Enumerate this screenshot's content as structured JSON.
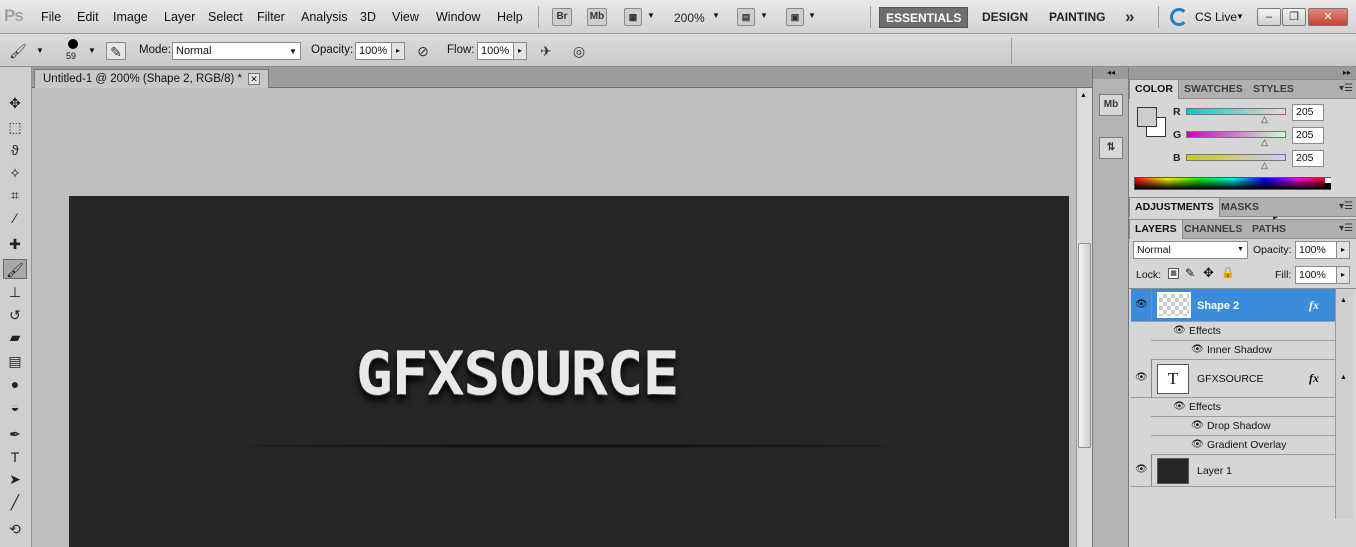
{
  "menubar": {
    "logo": "Ps",
    "items": [
      "File",
      "Edit",
      "Image",
      "Layer",
      "Select",
      "Filter",
      "Analysis",
      "3D",
      "View",
      "Window",
      "Help"
    ],
    "br_label": "Br",
    "mb_label": "Mb",
    "zoom": "200%",
    "workspaces": {
      "essentials": "ESSENTIALS",
      "design": "DESIGN",
      "painting": "PAINTING"
    },
    "more": "»",
    "cs_live": "CS Live",
    "win_min": "–",
    "win_restore": "❐",
    "win_close": "✕"
  },
  "options": {
    "brush_size": "59",
    "mode_label": "Mode:",
    "mode_value": "Normal",
    "opacity_label": "Opacity:",
    "opacity_value": "100%",
    "flow_label": "Flow:",
    "flow_value": "100%"
  },
  "document": {
    "tab_title": "Untitled-1 @ 200% (Shape 2, RGB/8) *",
    "close": "✕",
    "canvas_text": "GFXSOURCE",
    "canvas_color": "#262626"
  },
  "color_panel": {
    "tabs": [
      "COLOR",
      "SWATCHES",
      "STYLES"
    ],
    "channels": [
      {
        "label": "R",
        "value": "205",
        "fraction": 0.8
      },
      {
        "label": "G",
        "value": "205",
        "fraction": 0.8
      },
      {
        "label": "B",
        "value": "205",
        "fraction": 0.8
      }
    ]
  },
  "adjust_panel": {
    "tabs": [
      "ADJUSTMENTS",
      "MASKS"
    ]
  },
  "layers_panel": {
    "tabs": [
      "LAYERS",
      "CHANNELS",
      "PATHS"
    ],
    "blend_mode": "Normal",
    "opacity_label": "Opacity:",
    "opacity_value": "100%",
    "lock_label": "Lock:",
    "fill_label": "Fill:",
    "fill_value": "100%",
    "layers": [
      {
        "name": "Shape 2",
        "effects_label": "Effects",
        "effects": [
          "Inner Shadow"
        ]
      },
      {
        "name": "GFXSOURCE",
        "thumb_glyph": "T",
        "effects_label": "Effects",
        "effects": [
          "Drop Shadow",
          "Gradient Overlay"
        ]
      },
      {
        "name": "Layer 1"
      }
    ],
    "fx": "fx"
  },
  "dock": {
    "mb_label": "Mb"
  }
}
